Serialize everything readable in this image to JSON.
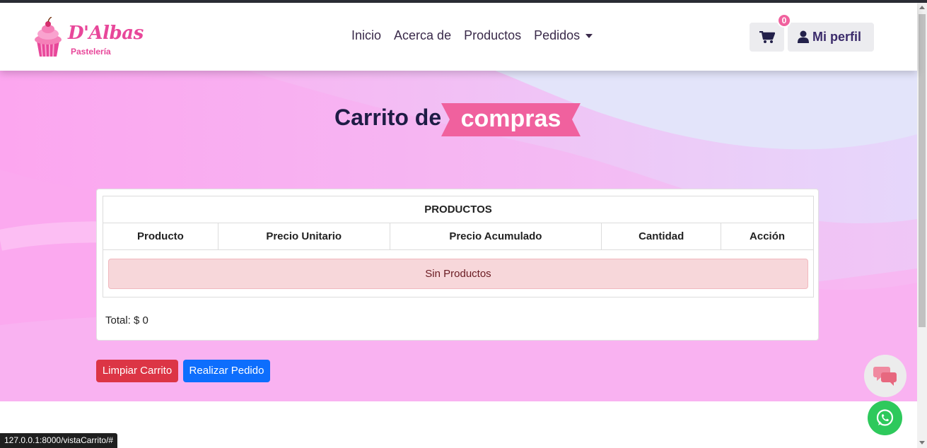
{
  "brand": {
    "name": "D'Albas",
    "subtitle": "Pastelería"
  },
  "nav": {
    "links": [
      "Inicio",
      "Acerca de",
      "Productos",
      "Pedidos"
    ],
    "cart_count": "0",
    "profile_label": "Mi perfil"
  },
  "page": {
    "title_part1": "Carrito de",
    "title_part2": "compras"
  },
  "table": {
    "caption": "PRODUCTOS",
    "columns": [
      "Producto",
      "Precio Unitario",
      "Precio Acumulado",
      "Cantidad",
      "Acción"
    ],
    "empty_message": "Sin Productos"
  },
  "total_label": "Total: $ 0",
  "actions": {
    "clear": "Limpiar Carrito",
    "order": "Realizar Pedido"
  },
  "status_url": "127.0.0.1:8000/vistaCarrito/#",
  "colors": {
    "accent_pink": "#f0619e",
    "danger": "#dc3545",
    "primary": "#0d6efd",
    "whatsapp": "#2ec95c"
  }
}
